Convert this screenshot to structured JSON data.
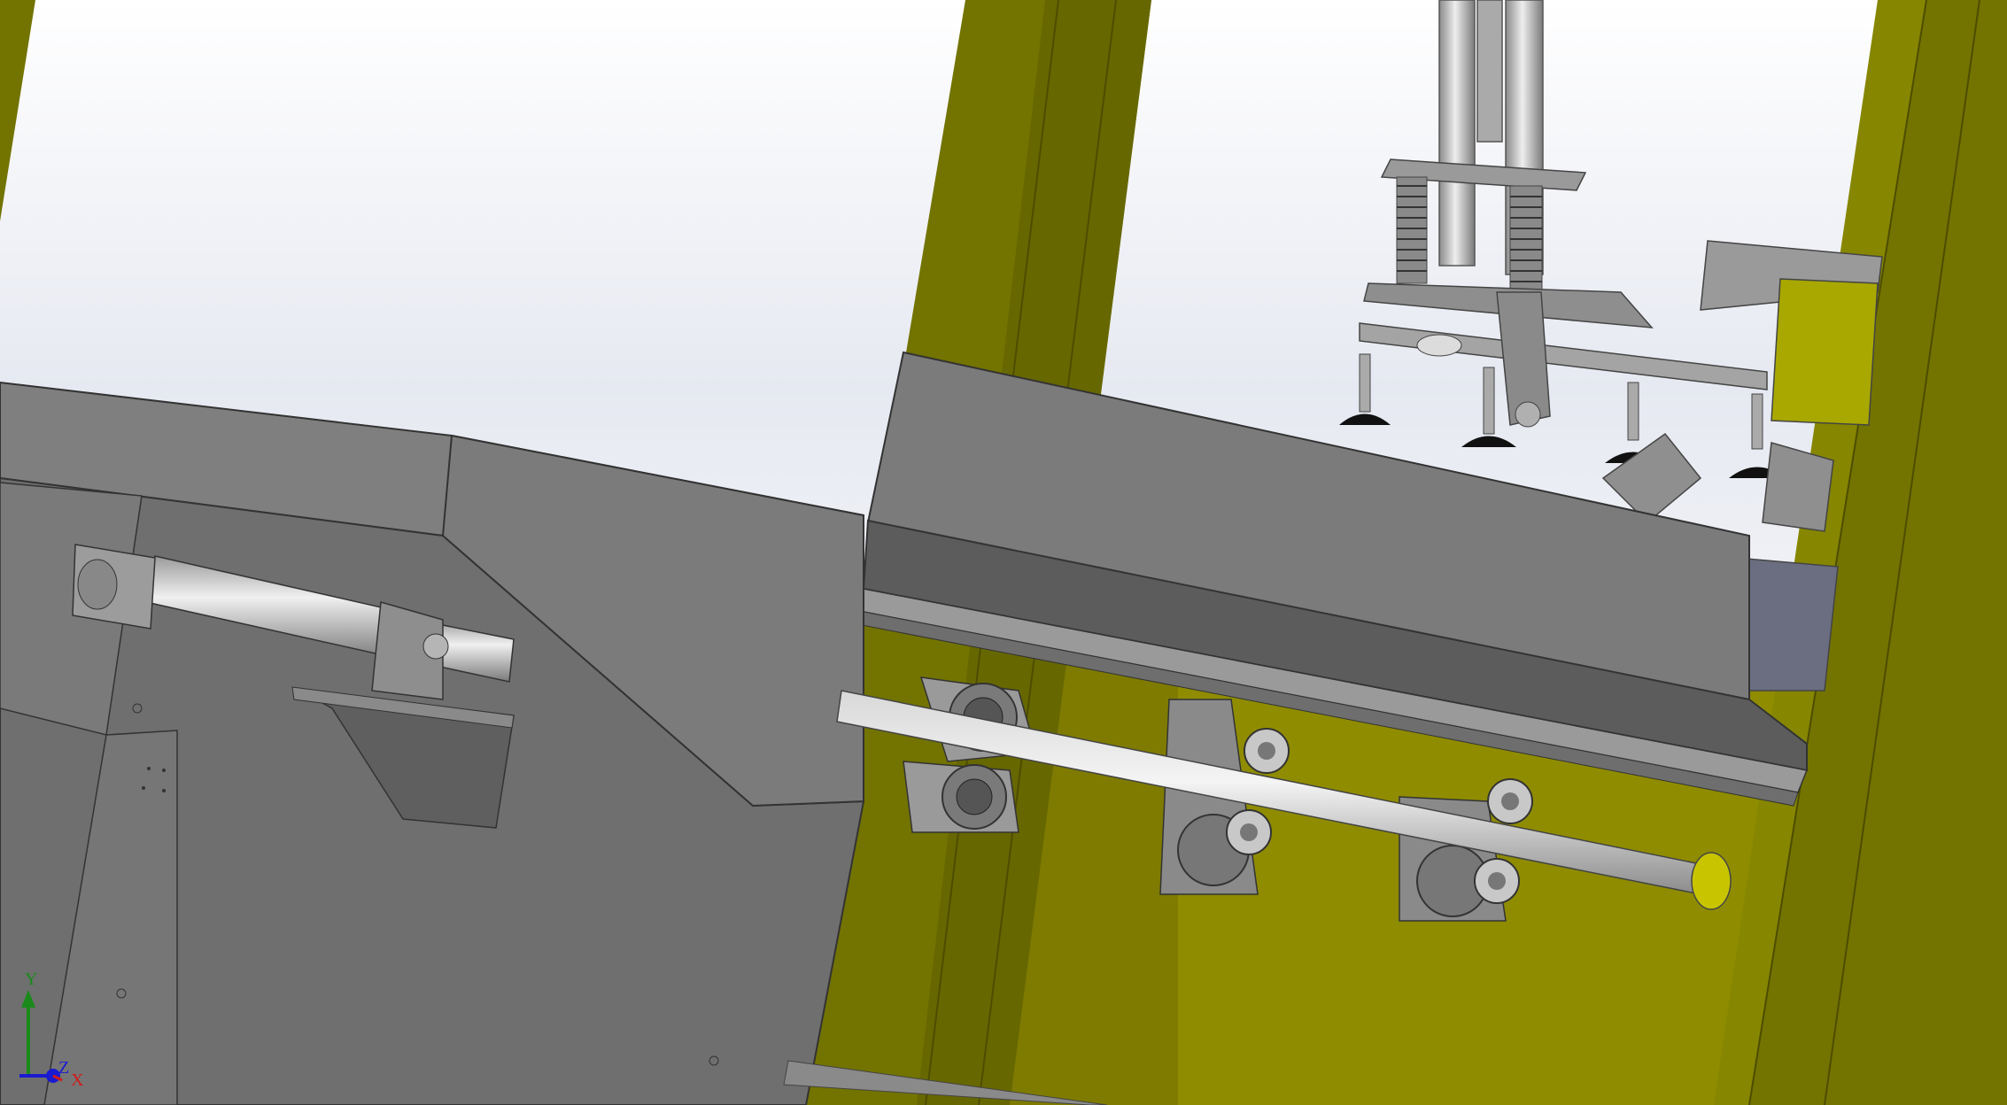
{
  "viewport": {
    "background_top": "#f2f4f8",
    "background_bottom": "#ffffff",
    "frame_color": "#737300",
    "frame_dark": "#5a5a00",
    "panel_yellow": "#9a9600",
    "sheet_metal": "#7c7c7c",
    "sheet_metal_dark": "#5f5f5f",
    "sheet_metal_light": "#969696",
    "shaft_color": "#b8b8b8"
  },
  "triad": {
    "x_label": "X",
    "y_label": "Y",
    "z_label": "Z",
    "x_color": "#d11a1a",
    "y_color": "#1a8a1a",
    "z_color": "#1a1ad1"
  }
}
